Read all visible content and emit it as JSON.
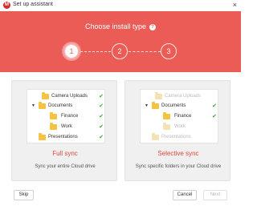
{
  "window": {
    "title": "Set up assistant",
    "close_glyph": "×",
    "app_icon_glyph": "M"
  },
  "header": {
    "title": "Choose install type",
    "help_glyph": "?",
    "steps": [
      "1",
      "2",
      "3"
    ],
    "active_step": 1
  },
  "full_sync": {
    "title": "Full sync",
    "description": "Sync your entire Cloud drive",
    "tree": [
      {
        "label": "Camera Uploads",
        "checked": true
      },
      {
        "label": "Documents",
        "checked": true,
        "expanded": true
      },
      {
        "label": "Finance",
        "checked": true
      },
      {
        "label": "Work",
        "checked": true
      },
      {
        "label": "Presentations",
        "checked": true
      }
    ]
  },
  "selective_sync": {
    "title": "Selective sync",
    "description": "Sync specific folders in your Cloud drive",
    "tree": [
      {
        "label": "Camera Uploads",
        "checked": false
      },
      {
        "label": "Documents",
        "checked": true,
        "expanded": true
      },
      {
        "label": "Finance",
        "checked": true
      },
      {
        "label": "Work",
        "checked": false
      },
      {
        "label": "Presentations",
        "checked": false
      }
    ]
  },
  "footer": {
    "skip_label": "Skip",
    "cancel_label": "Cancel",
    "next_label": "Next"
  },
  "icons": {
    "check": "✔",
    "caret": "▼"
  },
  "colors": {
    "accent": "#ea5c55",
    "panel_title": "#e4453d",
    "check": "#3aaa35",
    "folder": "#f5c242"
  }
}
